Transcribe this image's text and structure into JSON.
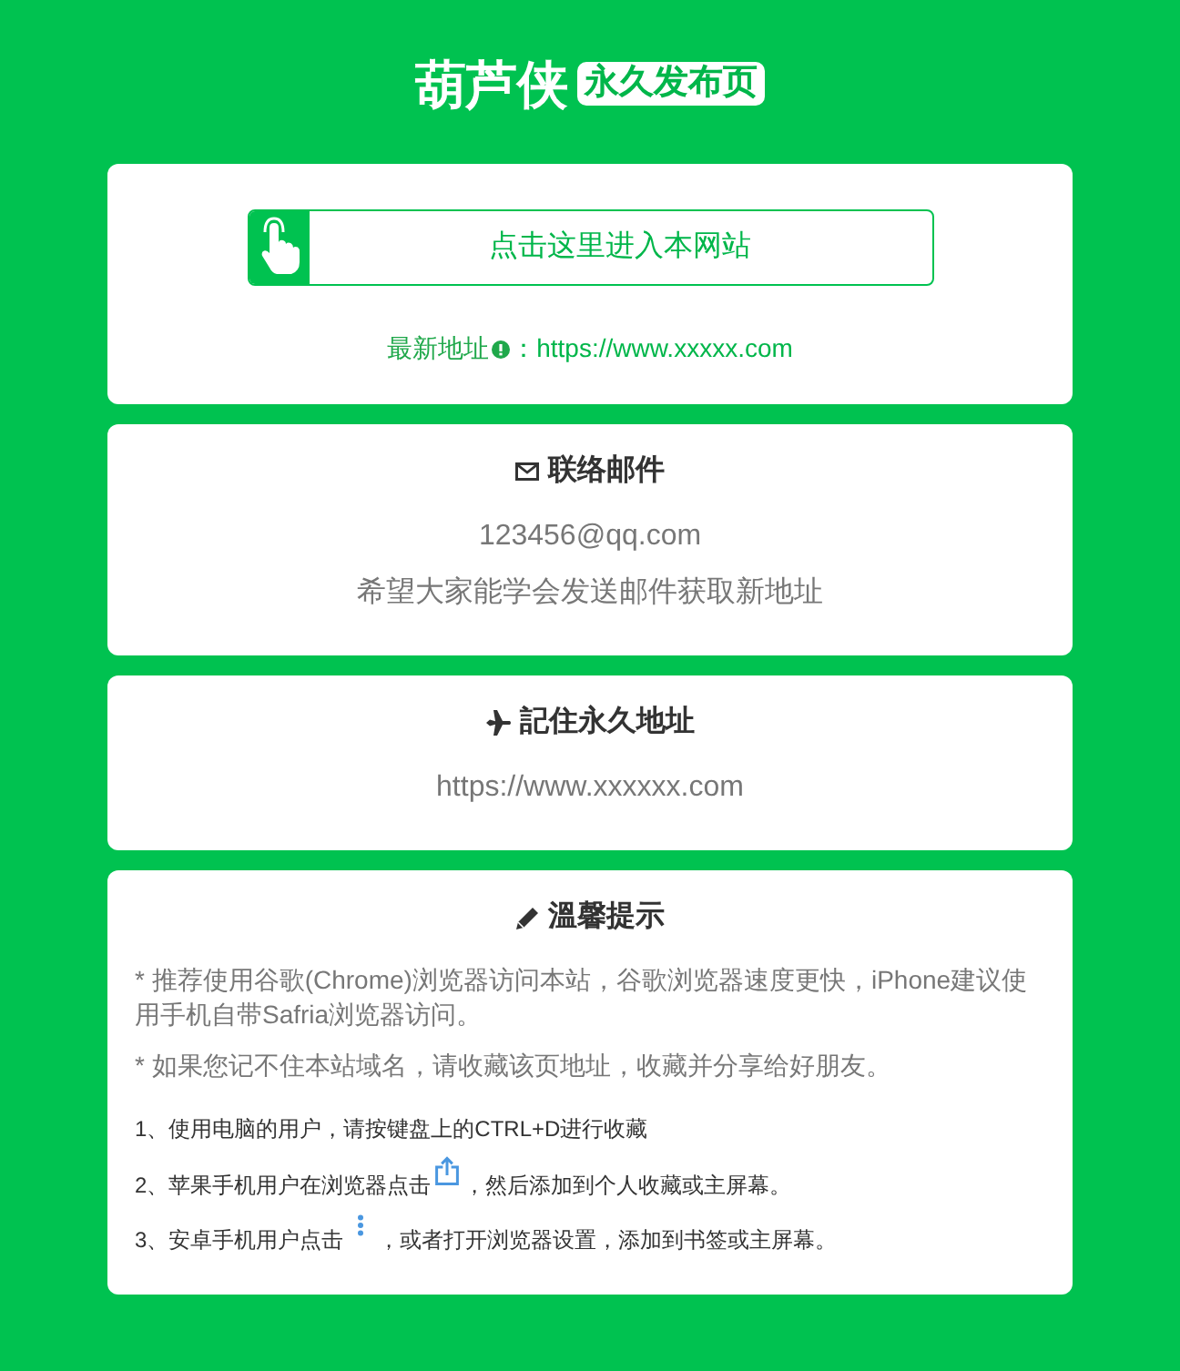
{
  "header": {
    "title": "葫芦侠",
    "badge": "永久发布页"
  },
  "entry": {
    "button": "点击这里进入本网站",
    "latest_label": "最新地址",
    "latest_url": "：https://www.xxxxx.com"
  },
  "cards": [
    {
      "title": "联络邮件",
      "lines": [
        "123456@qq.com",
        "希望大家能学会发送邮件获取新地址"
      ]
    },
    {
      "title": "記住永久地址",
      "lines": [
        "https://www.xxxxxx.com"
      ]
    }
  ],
  "tips": {
    "title": "溫馨提示",
    "notes": [
      "* 推荐使用谷歌(Chrome)浏览器访问本站，谷歌浏览器速度更快，iPhone建议使用手机自带Safria浏览器访问。",
      "* 如果您记不住本站域名，请收藏该页地址，收藏并分享给好朋友。"
    ],
    "steps": [
      {
        "text": "1、使用电脑的用户，请按键盘上的CTRL+D进行收藏"
      },
      {
        "text": "2、苹果手机用户在浏览器点击",
        "after": "，然后添加到个人收藏或主屏幕。"
      },
      {
        "text": "3、安卓手机用户点击",
        "after": "，或者打开浏览器设置，添加到书签或主屏幕。"
      }
    ]
  }
}
